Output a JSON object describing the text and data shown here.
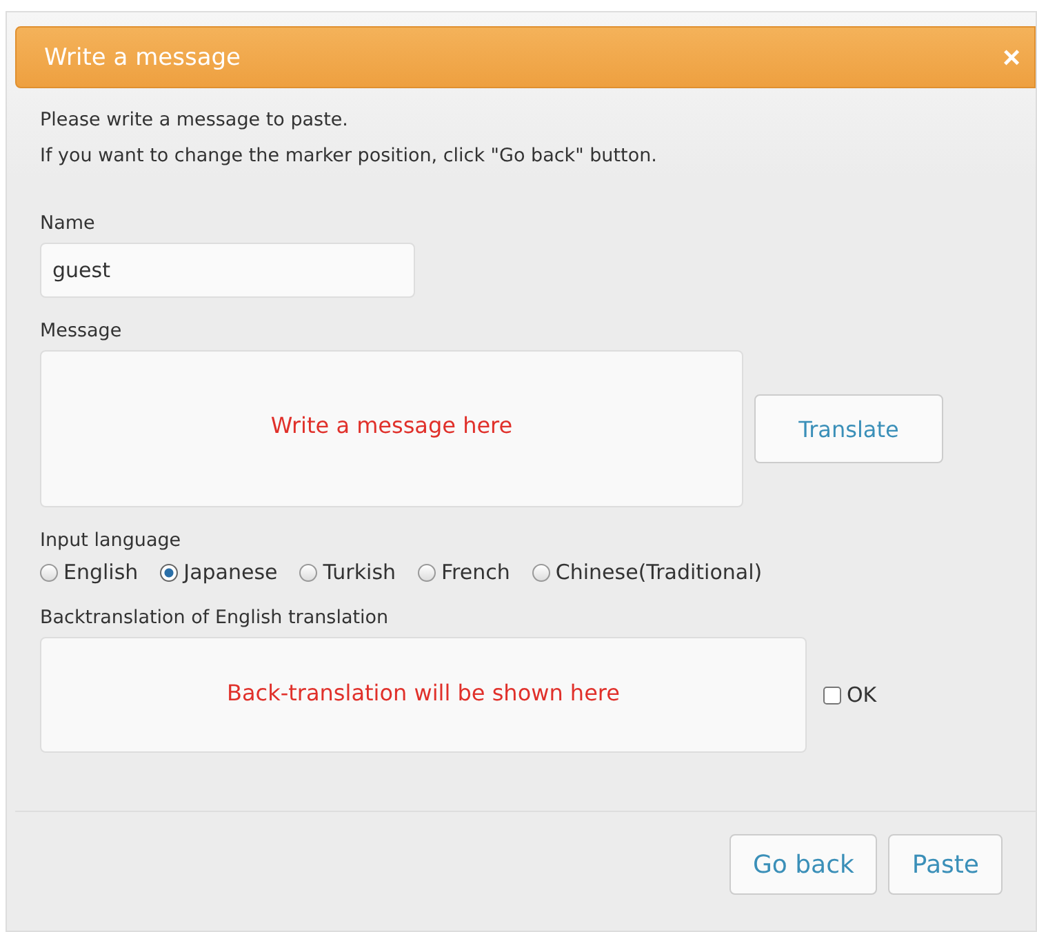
{
  "dialog": {
    "title": "Write a message",
    "close": "×"
  },
  "intro": [
    "Please write a message to paste.",
    "If you want to change the marker position, click \"Go back\" button."
  ],
  "name": {
    "label": "Name",
    "value": "guest"
  },
  "message": {
    "label": "Message",
    "placeholder": "Write a message here"
  },
  "translate_button": "Translate",
  "input_language": {
    "label": "Input language",
    "options": [
      {
        "label": "English",
        "selected": false
      },
      {
        "label": "Japanese",
        "selected": true
      },
      {
        "label": "Turkish",
        "selected": false
      },
      {
        "label": "French",
        "selected": false
      },
      {
        "label": "Chinese(Traditional)",
        "selected": false
      }
    ]
  },
  "backtranslation": {
    "label": "Backtranslation of English translation",
    "placeholder": "Back-translation will be shown here",
    "ok": {
      "label": "OK",
      "checked": false
    }
  },
  "buttons": [
    "Go back",
    "Paste"
  ]
}
